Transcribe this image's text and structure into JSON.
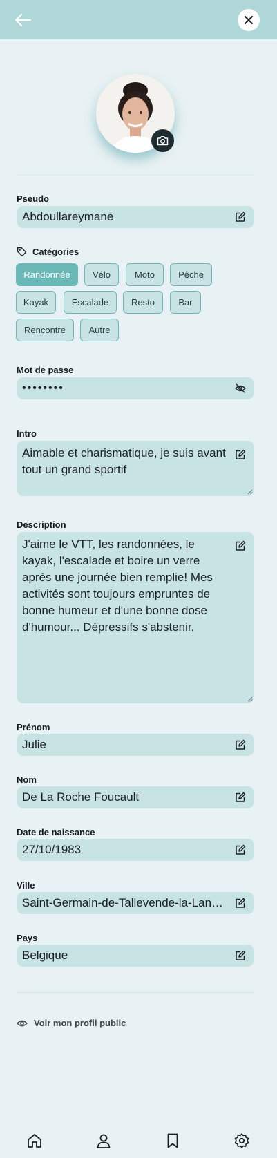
{
  "profile": {
    "pseudo_label": "Pseudo",
    "pseudo_value": "Abdoullareymane",
    "categories_label": "Catégories",
    "categories": [
      {
        "label": "Randonnée",
        "active": true
      },
      {
        "label": "Vélo",
        "active": false
      },
      {
        "label": "Moto",
        "active": false
      },
      {
        "label": "Pêche",
        "active": false
      },
      {
        "label": "Kayak",
        "active": false
      },
      {
        "label": "Escalade",
        "active": false
      },
      {
        "label": "Resto",
        "active": false
      },
      {
        "label": "Bar",
        "active": false
      },
      {
        "label": "Rencontre",
        "active": false
      },
      {
        "label": "Autre",
        "active": false
      }
    ],
    "password_label": "Mot de passe",
    "password_value": "••••••••",
    "intro_label": "Intro",
    "intro_value": "Aimable et charismatique, je suis avant tout un grand sportif",
    "description_label": "Description",
    "description_value": "J'aime le VTT, les randonnées, le kayak, l'escalade et boire un verre après une journée bien remplie! Mes activités sont toujours empruntes de bonne humeur et d'une bonne dose d'humour... Dépressifs s'abstenir.",
    "firstname_label": "Prénom",
    "firstname_value": "Julie",
    "lastname_label": "Nom",
    "lastname_value": "De La Roche Foucault",
    "birthdate_label": "Date de naissance",
    "birthdate_value": "27/10/1983",
    "city_label": "Ville",
    "city_value": "Saint-Germain-de-Tallevende-la-Lande-Vaumont",
    "country_label": "Pays",
    "country_value": "Belgique",
    "public_profile_link": "Voir mon profil public"
  },
  "icons": {
    "header_left": "arrow-left-icon",
    "header_right": "close-icon",
    "avatar_action": "camera-icon",
    "field_action": "edit-icon",
    "password_action": "eye-off-icon",
    "categories": "tag-icon",
    "public_link": "eye-icon",
    "nav": [
      "home-icon",
      "user-icon",
      "bookmark-icon",
      "settings-icon"
    ]
  },
  "colors": {
    "header": "#afd7d7",
    "background": "#e8f1f3",
    "field": "#c7e3e3",
    "chip_active": "#6bb8b8",
    "chip_border": "#6fb6b6"
  }
}
